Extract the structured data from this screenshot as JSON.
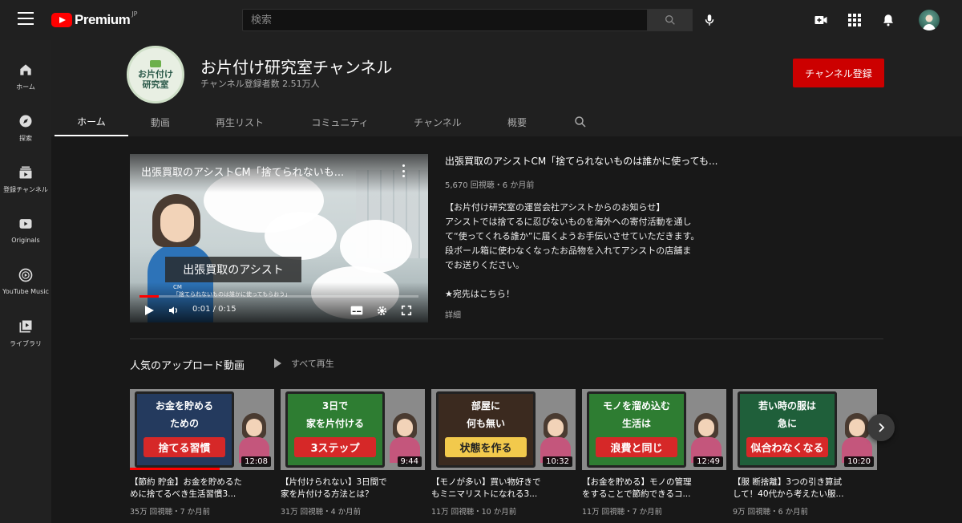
{
  "header": {
    "logo_text": "Premium",
    "logo_sup": "JP",
    "search_placeholder": "検索"
  },
  "sidebar": {
    "items": [
      {
        "label": "ホーム",
        "icon": "home-icon"
      },
      {
        "label": "探索",
        "icon": "compass-icon"
      },
      {
        "label": "登録チャンネル",
        "icon": "subscriptions-icon"
      },
      {
        "label": "Originals",
        "icon": "originals-icon"
      },
      {
        "label": "YouTube Music",
        "icon": "music-icon"
      },
      {
        "label": "ライブラリ",
        "icon": "library-icon"
      }
    ]
  },
  "channel": {
    "avatar_line1": "お片付け",
    "avatar_line2": "研究室",
    "name": "お片付け研究室チャンネル",
    "subscribers": "チャンネル登録者数 2.51万人",
    "subscribe_label": "チャンネル登録",
    "tabs": [
      "ホーム",
      "動画",
      "再生リスト",
      "コミュニティ",
      "チャンネル",
      "概要"
    ],
    "active_tab": "ホーム"
  },
  "featured": {
    "player_title": "出張買取のアシストCM「捨てられないも...",
    "caption": "出張買取のアシスト",
    "caption_sub1": "CM",
    "caption_sub2": "「捨てられないものは誰かに使ってもらおう」",
    "time": "0:01 / 0:15",
    "progress": 0.07,
    "title": "出張買取のアシストCM「捨てられないものは誰かに使っても...",
    "meta": "5,670 回視聴・6 か月前",
    "description": [
      "【お片付け研究室の運営会社アシストからのお知らせ】",
      "アシストでは捨てるに忍びないものを海外への寄付活動を通し",
      "て“使ってくれる誰か”に届くようお手伝いさせていただきます。",
      "段ボール箱に使わなくなったお品物を入れてアシストの店舗ま",
      "でお送りください。",
      "",
      "★宛先はこちら！"
    ],
    "more_label": "詳細"
  },
  "shelf": {
    "title": "人気のアップロード動画",
    "play_all_label": "すべて再生",
    "videos": [
      {
        "thumb_lines": [
          "お金を貯める",
          "ための",
          "捨てる習慣"
        ],
        "card_bg": "#243a5e",
        "card_text_color": "#ffffff",
        "accent_bg": "#d62828",
        "duration": "12:08",
        "watched": 0.62,
        "title1": "【節約 貯金】お金を貯めるた",
        "title2": "めに捨てるべき生活習慣3...",
        "meta": "35万 回視聴・7 か月前"
      },
      {
        "thumb_lines": [
          "3日で",
          "家を片付ける",
          "3ステップ"
        ],
        "card_bg": "#2e7d32",
        "card_text_color": "#ffffff",
        "accent_bg": "#d62828",
        "duration": "9:44",
        "watched": 0,
        "title1": "【片付けられない】3日間で",
        "title2": "家を片付ける方法とは？",
        "meta": "31万 回視聴・4 か月前"
      },
      {
        "thumb_lines": [
          "部屋に",
          "何も無い",
          "状態を作る"
        ],
        "card_bg": "#3b2a1f",
        "card_text_color": "#ffffff",
        "accent_bg": "#f2c94c",
        "duration": "10:32",
        "watched": 0,
        "title1": "【モノが多い】買い物好きで",
        "title2": "もミニマリストになれる3...",
        "meta": "11万 回視聴・10 か月前"
      },
      {
        "thumb_lines": [
          "モノを溜め込む",
          "生活は",
          "浪費と同じ"
        ],
        "card_bg": "#2e7d32",
        "card_text_color": "#ffffff",
        "accent_bg": "#d62828",
        "duration": "12:49",
        "watched": 0,
        "title1": "【お金を貯める】モノの管理",
        "title2": "をすることで節約できるコ...",
        "meta": "11万 回視聴・7 か月前"
      },
      {
        "thumb_lines": [
          "若い時の服は",
          "急に",
          "似合わなくなる"
        ],
        "card_bg": "#1f5f3a",
        "card_text_color": "#ffffff",
        "accent_bg": "#d62828",
        "duration": "10:20",
        "watched": 0,
        "title1": "【服 断捨離】3つの引き算試",
        "title2": "して！40代から考えたい服...",
        "meta": "9万 回視聴・6 か月前"
      }
    ]
  },
  "colors": {
    "brand_red": "#ff0000",
    "subscribe_red": "#cc0000",
    "background": "#181818",
    "panel": "#202020"
  }
}
